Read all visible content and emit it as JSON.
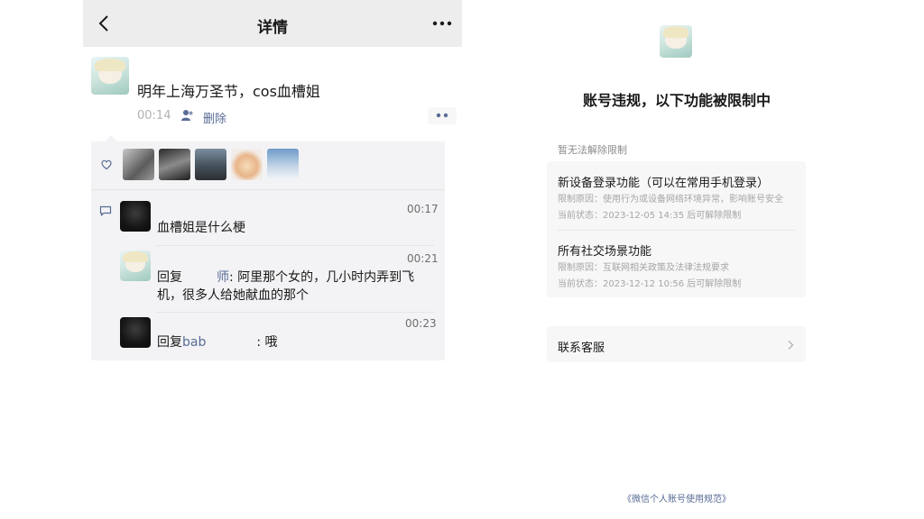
{
  "left": {
    "nav": {
      "title": "详情",
      "back_icon": "chevron-left-icon",
      "more_icon": "more-dots-icon"
    },
    "post": {
      "text": "明年上海万圣节，cos血槽姐",
      "time": "00:14",
      "delete_label": "删除",
      "people_icon": "people-icon"
    },
    "likes": {
      "icon": "heart-icon",
      "count_shown": 5
    },
    "comments": [
      {
        "time": "00:17",
        "text": "血槽姐是什么梗"
      },
      {
        "time": "00:21",
        "reply_prefix": "回复",
        "reply_to_suffix": "师",
        "text": ": 阿里那个女的，几小时内弄到飞机，很多人给她献血的那个"
      },
      {
        "time": "00:23",
        "reply_prefix": "回复",
        "reply_to": "bab",
        "text": ": 哦"
      }
    ]
  },
  "right": {
    "title": "账号违规，以下功能被限制中",
    "section_label": "暂无法解除限制",
    "features": [
      {
        "title": "新设备登录功能（可以在常用手机登录）",
        "reason": "限制原因：使用行为或设备网络环境异常，影响账号安全",
        "status": "当前状态：2023-12-05 14:35 后可解除限制"
      },
      {
        "title": "所有社交场景功能",
        "reason": "限制原因：互联网相关政策及法律法规要求",
        "status": "当前状态：2023-12-12 10:56 后可解除限制"
      }
    ],
    "contact_label": "联系客服",
    "footer_link": "《微信个人账号使用规范》"
  },
  "colors": {
    "link": "#576b95",
    "nav_bg": "#ededed",
    "feed_bg": "#f3f3f5"
  }
}
